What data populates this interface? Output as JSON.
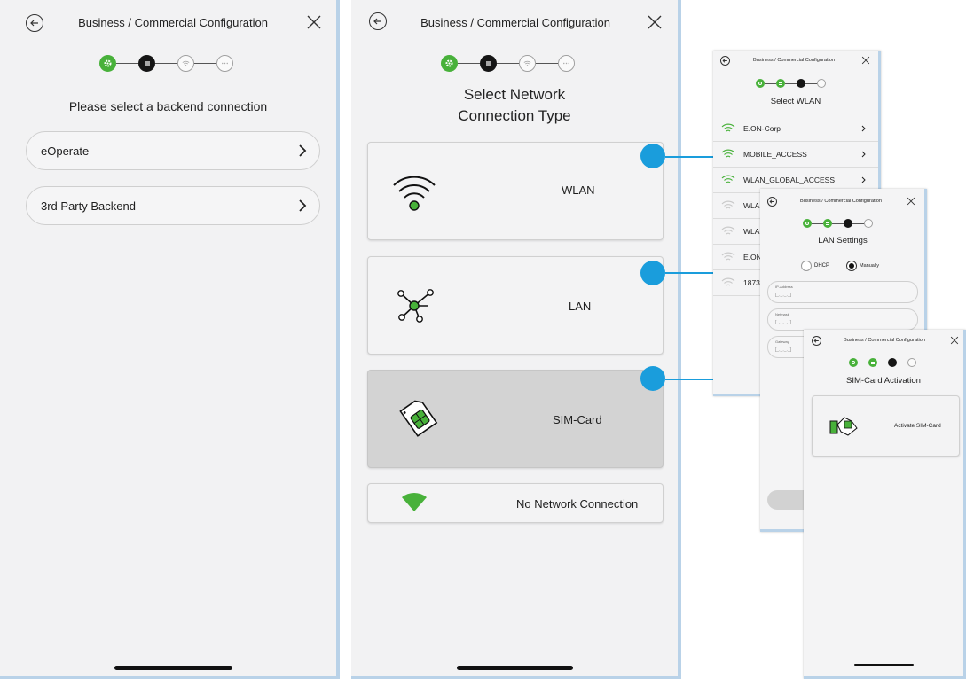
{
  "header": {
    "title": "Business / Commercial Configuration"
  },
  "screen1": {
    "heading": "Please select a backend connection",
    "options": [
      {
        "label": "eOperate"
      },
      {
        "label": "3rd Party Backend"
      }
    ]
  },
  "screen2": {
    "heading_line1": "Select Network",
    "heading_line2": "Connection Type",
    "options": [
      {
        "label": "WLAN",
        "icon": "wifi-icon"
      },
      {
        "label": "LAN",
        "icon": "network-icon"
      },
      {
        "label": "SIM-Card",
        "icon": "sim-card-icon",
        "selected": true
      },
      {
        "label": "No Network Connection",
        "icon": "no-network-icon"
      }
    ]
  },
  "wlan_screen": {
    "heading": "Select WLAN",
    "networks": [
      "E.ON-Corp",
      "MOBILE_ACCESS",
      "WLAN_GLOBAL_ACCESS",
      "WLA",
      "WLA",
      "E.ON",
      "1873"
    ]
  },
  "lan_screen": {
    "heading": "LAN Settings",
    "radio_dhcp": "DHCP",
    "radio_manual": "Manually",
    "selected_mode": "Manually",
    "fields": [
      {
        "label": "IP-Address",
        "placeholder": "[_._._._]"
      },
      {
        "label": "Netmask",
        "placeholder": "[_._._._]"
      },
      {
        "label": "Gateway",
        "placeholder": "[_._._._]"
      }
    ]
  },
  "sim_screen": {
    "heading": "SIM-Card Activation",
    "action_label": "Activate SIM-Card"
  },
  "colors": {
    "accent_green": "#48b13a",
    "callout_blue": "#1a9ddc",
    "background": "#f2f2f3"
  }
}
